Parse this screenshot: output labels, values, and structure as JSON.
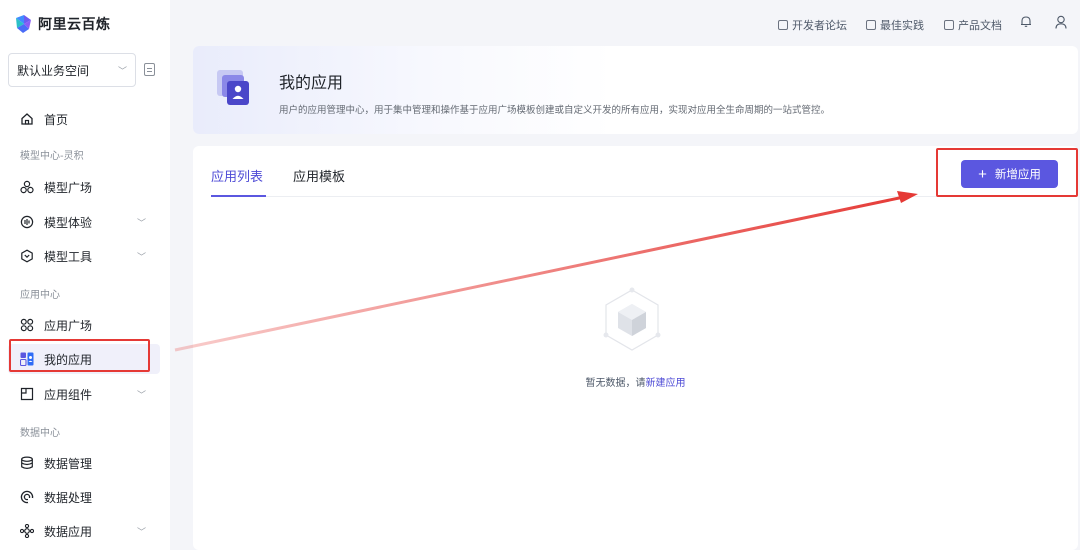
{
  "brand": {
    "name": "阿里云百炼",
    "accent": "#5b57e0"
  },
  "workspace": {
    "label": "默认业务空间"
  },
  "sidebar": {
    "home": "首页",
    "sections": [
      "模型中心-灵积",
      "应用中心",
      "数据中心"
    ],
    "items": [
      {
        "label": "模型广场",
        "icon": "plaza-icon"
      },
      {
        "label": "模型体验",
        "icon": "experience-icon",
        "expandable": true
      },
      {
        "label": "模型工具",
        "icon": "tool-icon",
        "expandable": true
      },
      {
        "label": "应用广场",
        "icon": "grid-icon"
      },
      {
        "label": "我的应用",
        "icon": "my-app-icon",
        "active": true
      },
      {
        "label": "应用组件",
        "icon": "component-icon",
        "expandable": true
      },
      {
        "label": "数据管理",
        "icon": "database-icon"
      },
      {
        "label": "数据处理",
        "icon": "processing-icon"
      },
      {
        "label": "数据应用",
        "icon": "data-app-icon",
        "expandable": true
      }
    ]
  },
  "topbar": {
    "links": [
      "开发者论坛",
      "最佳实践",
      "产品文档"
    ]
  },
  "header": {
    "title": "我的应用",
    "description": "用户的应用管理中心，用于集中管理和操作基于应用广场模板创建或自定义开发的所有应用，实现对应用全生命周期的一站式管控。"
  },
  "tabs": [
    "应用列表",
    "应用模板"
  ],
  "new_button": "新增应用",
  "empty": {
    "prefix": "暂无数据，请",
    "link": "新建应用"
  }
}
